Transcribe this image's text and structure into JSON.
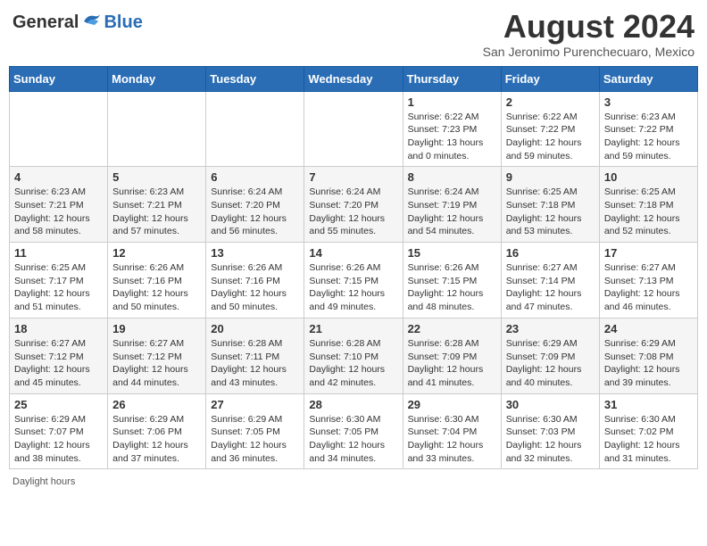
{
  "header": {
    "logo_general": "General",
    "logo_blue": "Blue",
    "month_year": "August 2024",
    "location": "San Jeronimo Purenchecuaro, Mexico"
  },
  "days_of_week": [
    "Sunday",
    "Monday",
    "Tuesday",
    "Wednesday",
    "Thursday",
    "Friday",
    "Saturday"
  ],
  "weeks": [
    [
      {
        "day": "",
        "info": ""
      },
      {
        "day": "",
        "info": ""
      },
      {
        "day": "",
        "info": ""
      },
      {
        "day": "",
        "info": ""
      },
      {
        "day": "1",
        "info": "Sunrise: 6:22 AM\nSunset: 7:23 PM\nDaylight: 13 hours\nand 0 minutes."
      },
      {
        "day": "2",
        "info": "Sunrise: 6:22 AM\nSunset: 7:22 PM\nDaylight: 12 hours\nand 59 minutes."
      },
      {
        "day": "3",
        "info": "Sunrise: 6:23 AM\nSunset: 7:22 PM\nDaylight: 12 hours\nand 59 minutes."
      }
    ],
    [
      {
        "day": "4",
        "info": "Sunrise: 6:23 AM\nSunset: 7:21 PM\nDaylight: 12 hours\nand 58 minutes."
      },
      {
        "day": "5",
        "info": "Sunrise: 6:23 AM\nSunset: 7:21 PM\nDaylight: 12 hours\nand 57 minutes."
      },
      {
        "day": "6",
        "info": "Sunrise: 6:24 AM\nSunset: 7:20 PM\nDaylight: 12 hours\nand 56 minutes."
      },
      {
        "day": "7",
        "info": "Sunrise: 6:24 AM\nSunset: 7:20 PM\nDaylight: 12 hours\nand 55 minutes."
      },
      {
        "day": "8",
        "info": "Sunrise: 6:24 AM\nSunset: 7:19 PM\nDaylight: 12 hours\nand 54 minutes."
      },
      {
        "day": "9",
        "info": "Sunrise: 6:25 AM\nSunset: 7:18 PM\nDaylight: 12 hours\nand 53 minutes."
      },
      {
        "day": "10",
        "info": "Sunrise: 6:25 AM\nSunset: 7:18 PM\nDaylight: 12 hours\nand 52 minutes."
      }
    ],
    [
      {
        "day": "11",
        "info": "Sunrise: 6:25 AM\nSunset: 7:17 PM\nDaylight: 12 hours\nand 51 minutes."
      },
      {
        "day": "12",
        "info": "Sunrise: 6:26 AM\nSunset: 7:16 PM\nDaylight: 12 hours\nand 50 minutes."
      },
      {
        "day": "13",
        "info": "Sunrise: 6:26 AM\nSunset: 7:16 PM\nDaylight: 12 hours\nand 50 minutes."
      },
      {
        "day": "14",
        "info": "Sunrise: 6:26 AM\nSunset: 7:15 PM\nDaylight: 12 hours\nand 49 minutes."
      },
      {
        "day": "15",
        "info": "Sunrise: 6:26 AM\nSunset: 7:15 PM\nDaylight: 12 hours\nand 48 minutes."
      },
      {
        "day": "16",
        "info": "Sunrise: 6:27 AM\nSunset: 7:14 PM\nDaylight: 12 hours\nand 47 minutes."
      },
      {
        "day": "17",
        "info": "Sunrise: 6:27 AM\nSunset: 7:13 PM\nDaylight: 12 hours\nand 46 minutes."
      }
    ],
    [
      {
        "day": "18",
        "info": "Sunrise: 6:27 AM\nSunset: 7:12 PM\nDaylight: 12 hours\nand 45 minutes."
      },
      {
        "day": "19",
        "info": "Sunrise: 6:27 AM\nSunset: 7:12 PM\nDaylight: 12 hours\nand 44 minutes."
      },
      {
        "day": "20",
        "info": "Sunrise: 6:28 AM\nSunset: 7:11 PM\nDaylight: 12 hours\nand 43 minutes."
      },
      {
        "day": "21",
        "info": "Sunrise: 6:28 AM\nSunset: 7:10 PM\nDaylight: 12 hours\nand 42 minutes."
      },
      {
        "day": "22",
        "info": "Sunrise: 6:28 AM\nSunset: 7:09 PM\nDaylight: 12 hours\nand 41 minutes."
      },
      {
        "day": "23",
        "info": "Sunrise: 6:29 AM\nSunset: 7:09 PM\nDaylight: 12 hours\nand 40 minutes."
      },
      {
        "day": "24",
        "info": "Sunrise: 6:29 AM\nSunset: 7:08 PM\nDaylight: 12 hours\nand 39 minutes."
      }
    ],
    [
      {
        "day": "25",
        "info": "Sunrise: 6:29 AM\nSunset: 7:07 PM\nDaylight: 12 hours\nand 38 minutes."
      },
      {
        "day": "26",
        "info": "Sunrise: 6:29 AM\nSunset: 7:06 PM\nDaylight: 12 hours\nand 37 minutes."
      },
      {
        "day": "27",
        "info": "Sunrise: 6:29 AM\nSunset: 7:05 PM\nDaylight: 12 hours\nand 36 minutes."
      },
      {
        "day": "28",
        "info": "Sunrise: 6:30 AM\nSunset: 7:05 PM\nDaylight: 12 hours\nand 34 minutes."
      },
      {
        "day": "29",
        "info": "Sunrise: 6:30 AM\nSunset: 7:04 PM\nDaylight: 12 hours\nand 33 minutes."
      },
      {
        "day": "30",
        "info": "Sunrise: 6:30 AM\nSunset: 7:03 PM\nDaylight: 12 hours\nand 32 minutes."
      },
      {
        "day": "31",
        "info": "Sunrise: 6:30 AM\nSunset: 7:02 PM\nDaylight: 12 hours\nand 31 minutes."
      }
    ]
  ],
  "footer": {
    "note": "Daylight hours"
  }
}
